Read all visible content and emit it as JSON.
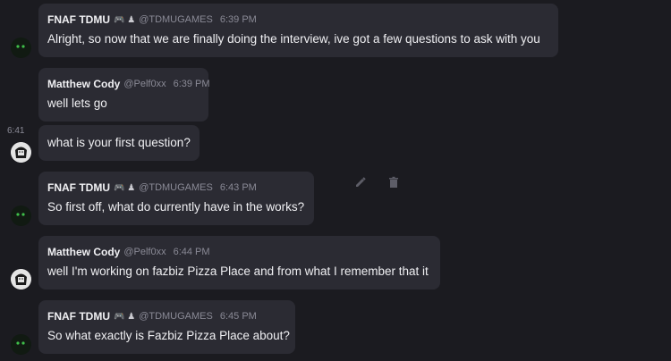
{
  "messages": [
    {
      "author": "FNAF TDMU",
      "badges": "🎮 ♟",
      "handle": "@TDMUGAMES",
      "time": "6:39 PM",
      "text": "Alright, so now that we are finally doing the interview, ive got a few questions to ask with you"
    },
    {
      "author": "Matthew Cody",
      "handle": "@Pelf0xx",
      "time": "6:39 PM",
      "text": "well lets go"
    },
    {
      "hover_time": "6:41",
      "text": "what is your first question?"
    },
    {
      "author": "FNAF TDMU",
      "badges": "🎮 ♟",
      "handle": "@TDMUGAMES",
      "time": "6:43 PM",
      "text": "So first off, what do currently have in the works?"
    },
    {
      "author": "Matthew Cody",
      "handle": "@Pelf0xx",
      "time": "6:44 PM",
      "text": "well I'm working on fazbiz Pizza Place and from what I remember that it"
    },
    {
      "author": "FNAF TDMU",
      "badges": "🎮 ♟",
      "handle": "@TDMUGAMES",
      "time": "6:45 PM",
      "text": "So what exactly is Fazbiz Pizza Place about?"
    }
  ],
  "actions": {
    "edit_icon": "pencil-icon",
    "delete_icon": "trash-icon"
  }
}
